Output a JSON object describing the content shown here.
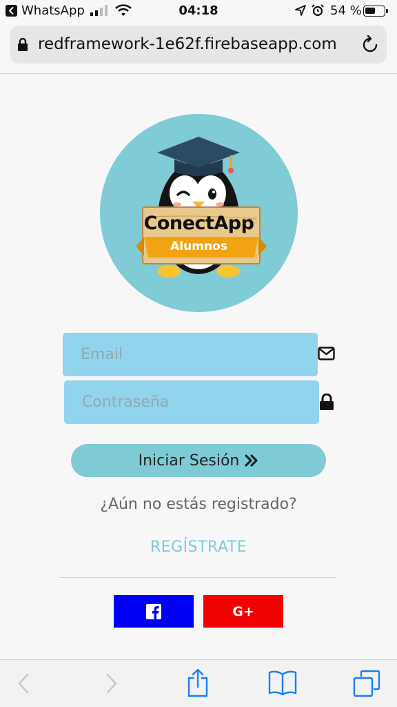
{
  "status_bar": {
    "app_name": "WhatsApp",
    "time": "04:18",
    "battery_percent_text": "54 %",
    "battery_level": 0.54,
    "icons": [
      "back-to-app-icon",
      "cellular-signal-icon",
      "wifi-icon",
      "location-arrow-icon",
      "alarm-icon",
      "battery-icon"
    ]
  },
  "browser": {
    "url": "redframework-1e62f.firebaseapp.com",
    "icons": [
      "lock-icon",
      "reload-icon"
    ]
  },
  "logo": {
    "title": "ConectApp",
    "subtitle": "Alumnos",
    "colors": {
      "circle": "#7fcbd6",
      "sign": "#e9c98b",
      "banner": "#f2a314"
    }
  },
  "form": {
    "email_placeholder": "Email",
    "password_placeholder": "Contraseña",
    "login_label": "Iniciar Sesión",
    "not_registered_text": "¿Aún no estás registrado?",
    "register_label": "REGÍSTRATE",
    "icons": [
      "envelope-icon",
      "padlock-icon",
      "double-chevron-right-icon"
    ]
  },
  "social": {
    "facebook": {
      "icon": "facebook-icon",
      "color": "#0000f5"
    },
    "google": {
      "label": "G+",
      "color": "#f10000"
    }
  },
  "toolbar": {
    "icons": [
      "back-arrow-icon",
      "forward-arrow-icon",
      "share-icon",
      "bookmarks-icon",
      "tabs-icon"
    ]
  },
  "colors": {
    "field_bg": "#92d3ed",
    "button_bg": "#7ecbd6",
    "link": "#7ecbd6"
  }
}
